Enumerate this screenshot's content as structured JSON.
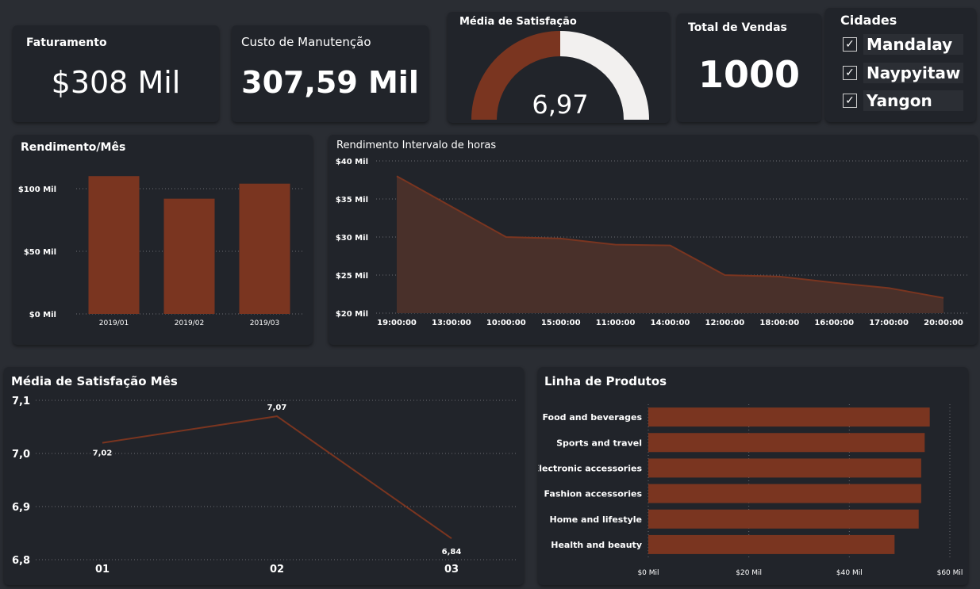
{
  "colors": {
    "accent": "#7a3520",
    "background": "#2a2d33",
    "card": "#21242a",
    "gauge_rest": "#f2f0ef"
  },
  "kpis": {
    "faturamento": {
      "title": "Faturamento",
      "value": "$308 Mil"
    },
    "custo": {
      "title": "Custo de Manutenção",
      "value": "307,59 Mil"
    },
    "satisfacao": {
      "title": "Média de Satisfação",
      "value": "6,97",
      "fraction": 0.5
    },
    "vendas": {
      "title": "Total de Vendas",
      "value": "1000"
    }
  },
  "slicer": {
    "title": "Cidades",
    "items": [
      {
        "label": "Mandalay",
        "checked": true
      },
      {
        "label": "Naypyitaw",
        "checked": true
      },
      {
        "label": "Yangon",
        "checked": true
      }
    ]
  },
  "chart_data": [
    {
      "id": "rendimento_mes",
      "type": "bar",
      "title": "Rendimento/Mês",
      "categories": [
        "2019/01",
        "2019/02",
        "2019/03"
      ],
      "values": [
        110,
        92,
        104
      ],
      "ylim": [
        0,
        100
      ],
      "yticks": [
        0,
        50,
        100
      ],
      "ytick_labels": [
        "$0 Mil",
        "$50 Mil",
        "$100 Mil"
      ],
      "grid": true
    },
    {
      "id": "rendimento_horas",
      "type": "area",
      "title": "Rendimento Intervalo de horas",
      "categories": [
        "19:00:00",
        "13:00:00",
        "10:00:00",
        "15:00:00",
        "11:00:00",
        "14:00:00",
        "12:00:00",
        "18:00:00",
        "16:00:00",
        "17:00:00",
        "20:00:00"
      ],
      "values": [
        38,
        34,
        30,
        29.8,
        29,
        28.9,
        25,
        24.8,
        24,
        23.3,
        22
      ],
      "ylim": [
        20,
        40
      ],
      "yticks": [
        20,
        25,
        30,
        35,
        40
      ],
      "ytick_labels": [
        "$20 Mil",
        "$25 Mil",
        "$30 Mil",
        "$35 Mil",
        "$40 Mil"
      ],
      "grid": true
    },
    {
      "id": "satisfacao_mes",
      "type": "line",
      "title": "Média de Satisfação Mês",
      "categories": [
        "01",
        "02",
        "03"
      ],
      "values": [
        7.02,
        7.07,
        6.84
      ],
      "data_labels": [
        "7,02",
        "7,07",
        "6,84"
      ],
      "ylim": [
        6.8,
        7.1
      ],
      "yticks": [
        6.8,
        6.9,
        7.0,
        7.1
      ],
      "ytick_labels": [
        "6,8",
        "6,9",
        "7,0",
        "7,1"
      ],
      "grid": true
    },
    {
      "id": "linha_produtos",
      "type": "bar",
      "orientation": "horizontal",
      "title": "Linha de Produtos",
      "categories": [
        "Food and beverages",
        "Sports and travel",
        "Electronic accessories",
        "Fashion accessories",
        "Home and lifestyle",
        "Health and beauty"
      ],
      "values": [
        56,
        55,
        54.3,
        54.3,
        53.8,
        49
      ],
      "xlim": [
        0,
        60
      ],
      "xticks": [
        0,
        20,
        40,
        60
      ],
      "xtick_labels": [
        "$0 Mil",
        "$20 Mil",
        "$40 Mil",
        "$60 Mil"
      ],
      "grid": true
    }
  ]
}
